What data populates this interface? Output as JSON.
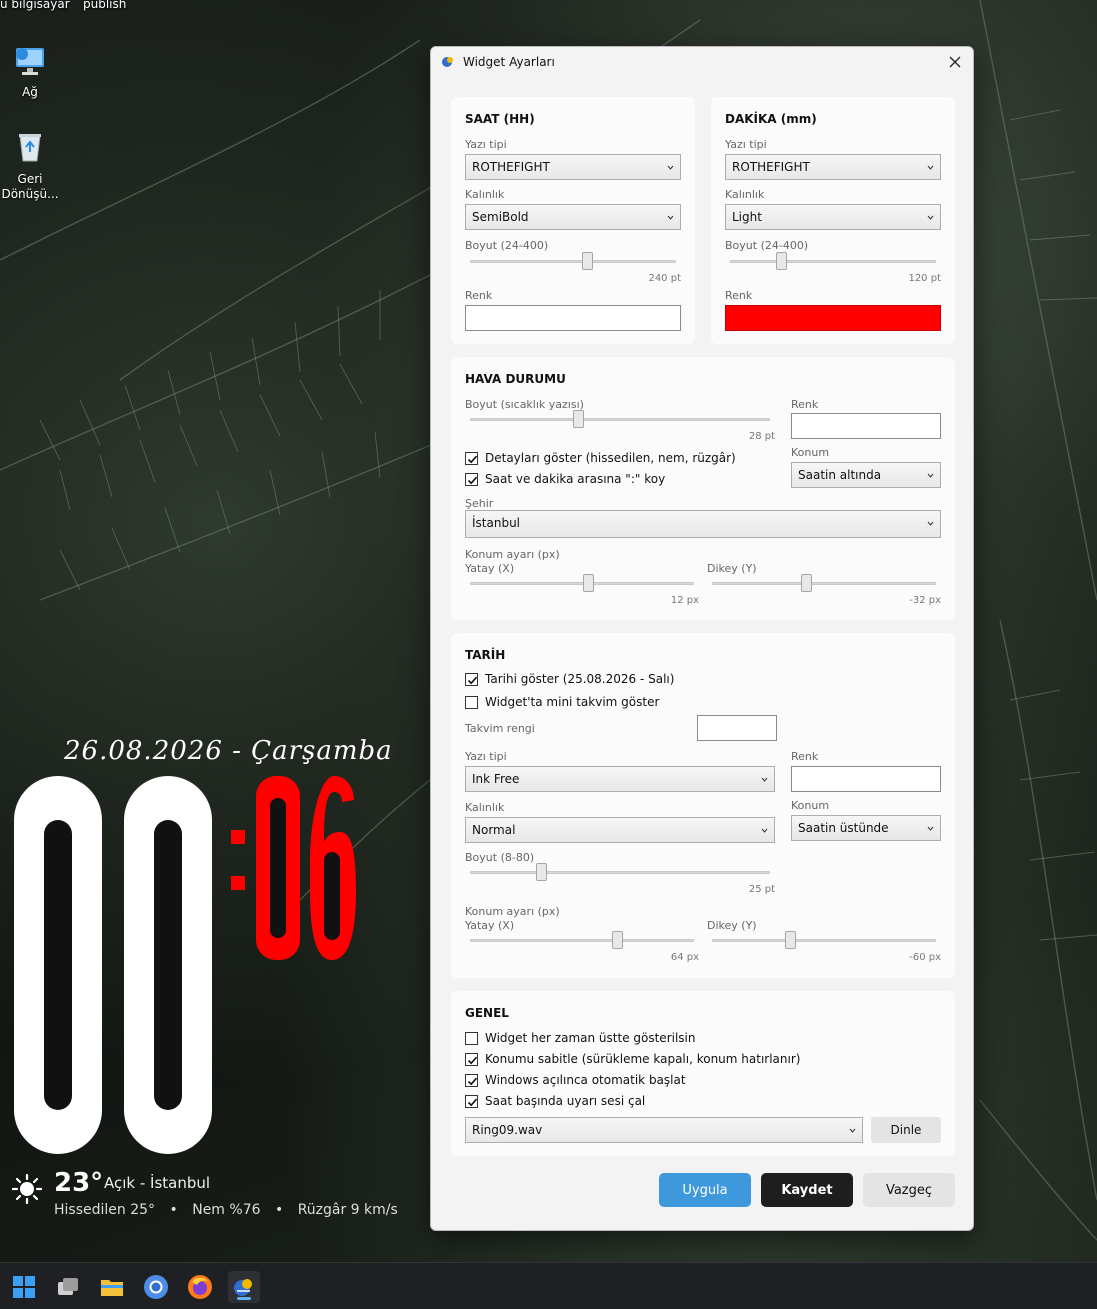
{
  "desktop": {
    "top_left_label": "u bilgisayar",
    "top_label_2": "publish",
    "icons": [
      {
        "label": "Ağ",
        "icon": "network-icon"
      },
      {
        "label": "Geri Dönüşü...",
        "icon": "recycle-bin-icon"
      }
    ]
  },
  "widget": {
    "date": "26.08.2026 - Çarşamba",
    "hour": "00",
    "minute": "06",
    "separator": ":",
    "temp": "23°",
    "condition": "Açık - İstanbul",
    "feels_like": "Hissedilen 25°",
    "humidity": "Nem %76",
    "wind": "Rüzgâr 9 km/s",
    "minute_color": "#ff0000",
    "hour_color": "#ffffff"
  },
  "dialog": {
    "title": "Widget Ayarları",
    "saat": {
      "title": "SAAT (HH)",
      "font_label": "Yazı tipi",
      "font_value": "ROTHEFIGHT",
      "weight_label": "Kalınlık",
      "weight_value": "SemiBold",
      "size_label": "Boyut (24-400)",
      "size_value": "240 pt",
      "size_level": 240,
      "color_label": "Renk",
      "color_value": "#ffffff"
    },
    "dakika": {
      "title": "DAKİKA (mm)",
      "font_label": "Yazı tipi",
      "font_value": "ROTHEFIGHT",
      "weight_label": "Kalınlık",
      "weight_value": "Light",
      "size_label": "Boyut (24-400)",
      "size_value": "120 pt",
      "size_level": 120,
      "color_label": "Renk",
      "color_value": "#ff0000"
    },
    "hava": {
      "title": "HAVA DURUMU",
      "size_label": "Boyut (sıcaklık yazısı)",
      "size_value": "28 pt",
      "color_label": "Renk",
      "color_value": "#ffffff",
      "position_label": "Konum",
      "position_value": "Saatin altında",
      "details_check": "Detayları göster (hissedilen, nem, rüzgâr)",
      "details_checked": true,
      "colon_check": "Saat ve dakika arasına \":\" koy",
      "colon_checked": true,
      "city_label": "Şehir",
      "city_value": "İstanbul",
      "offset_label": "Konum ayarı (px)",
      "x_label": "Yatay (X)",
      "x_value": "12 px",
      "y_label": "Dikey (Y)",
      "y_value": "-32 px"
    },
    "tarih": {
      "title": "TARİH",
      "show_check": "Tarihi göster (25.08.2026 - Salı)",
      "show_checked": true,
      "mini_check": "Widget'ta mini takvim göster",
      "mini_checked": false,
      "calendar_color_label": "Takvim rengi",
      "calendar_color_value": "#ffffff",
      "font_label": "Yazı tipi",
      "font_value": "Ink Free",
      "color_label": "Renk",
      "color_value": "#ffffff",
      "weight_label": "Kalınlık",
      "weight_value": "Normal",
      "position_label": "Konum",
      "position_value": "Saatin üstünde",
      "size_label": "Boyut (8-80)",
      "size_value": "25 pt",
      "offset_label": "Konum ayarı (px)",
      "x_label": "Yatay (X)",
      "x_value": "64 px",
      "y_label": "Dikey (Y)",
      "y_value": "-60 px"
    },
    "genel": {
      "title": "GENEL",
      "checks": [
        {
          "label": "Widget her zaman üstte gösterilsin",
          "checked": false
        },
        {
          "label": "Konumu sabitle (sürükleme kapalı, konum hatırlanır)",
          "checked": true
        },
        {
          "label": "Windows açılınca otomatik başlat",
          "checked": true
        },
        {
          "label": "Saat başında uyarı sesi çal",
          "checked": true
        }
      ],
      "sound_value": "Ring09.wav",
      "listen_label": "Dinle"
    },
    "buttons": {
      "apply": "Uygula",
      "save": "Kaydet",
      "cancel": "Vazgeç"
    }
  },
  "taskbar": {
    "icons": [
      "start-icon",
      "task-view-icon",
      "file-explorer-icon",
      "chrome-icon",
      "firefox-icon",
      "widget-app-icon"
    ]
  }
}
